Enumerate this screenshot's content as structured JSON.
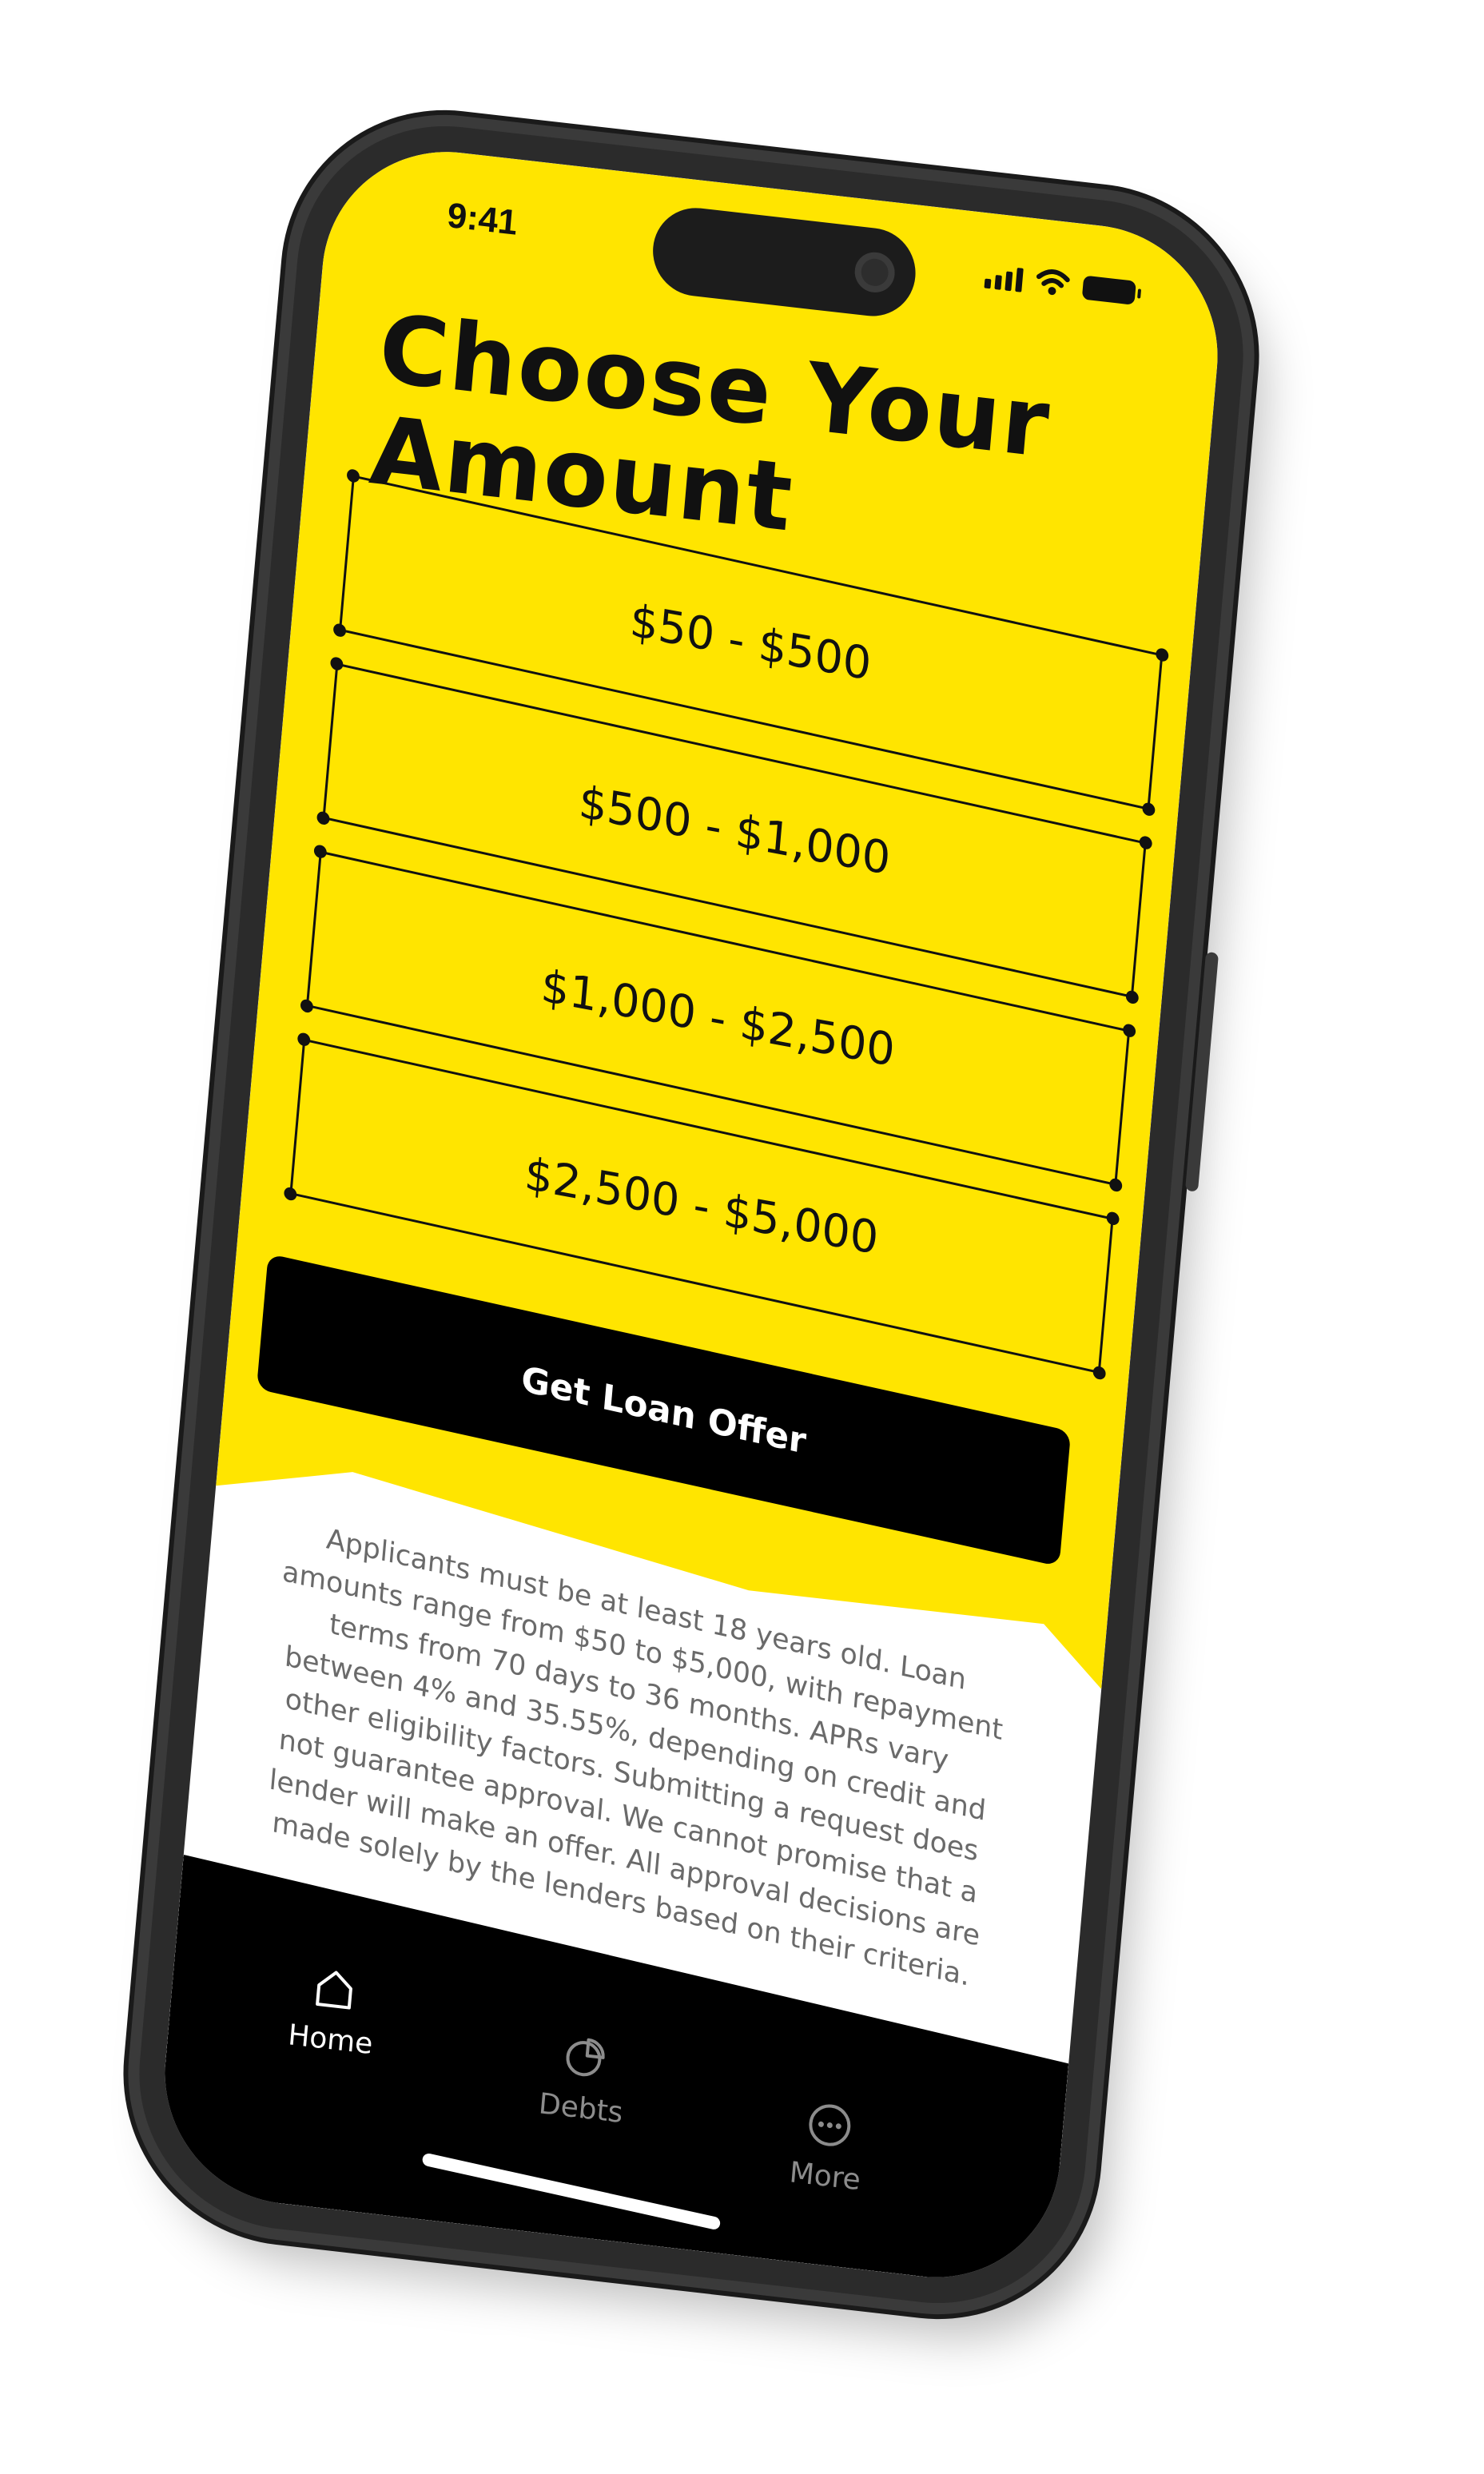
{
  "status_bar": {
    "time": "9:41"
  },
  "screen": {
    "title_line1": "Choose Your",
    "title_line2": "Amount",
    "options": [
      {
        "label": "$50 - $500"
      },
      {
        "label": "$500 - $1,000"
      },
      {
        "label": "$1,000 - $2,500"
      },
      {
        "label": "$2,500 - $5,000"
      }
    ],
    "cta_label": "Get Loan Offer",
    "disclaimer": "Applicants must be at least 18 years old. Loan amounts range from $50 to $5,000, with repayment terms from 70 days to 36 months. APRs vary between 4% and 35.55%, depending on credit and other eligibility factors. Submitting a request does not guarantee approval. We cannot promise that a lender will make an offer. All approval decisions are made solely by the lenders based on their criteria."
  },
  "tabbar": {
    "tabs": [
      {
        "label": "Home",
        "icon": "home-icon",
        "active": true
      },
      {
        "label": "Debts",
        "icon": "pie-chart-icon",
        "active": false
      },
      {
        "label": "More",
        "icon": "more-icon",
        "active": false
      }
    ]
  },
  "colors": {
    "accent": "#ffe500",
    "button_bg": "#000000",
    "text_primary": "#111111",
    "text_muted": "#6a6a6a",
    "tab_inactive": "#8c8c8c"
  }
}
